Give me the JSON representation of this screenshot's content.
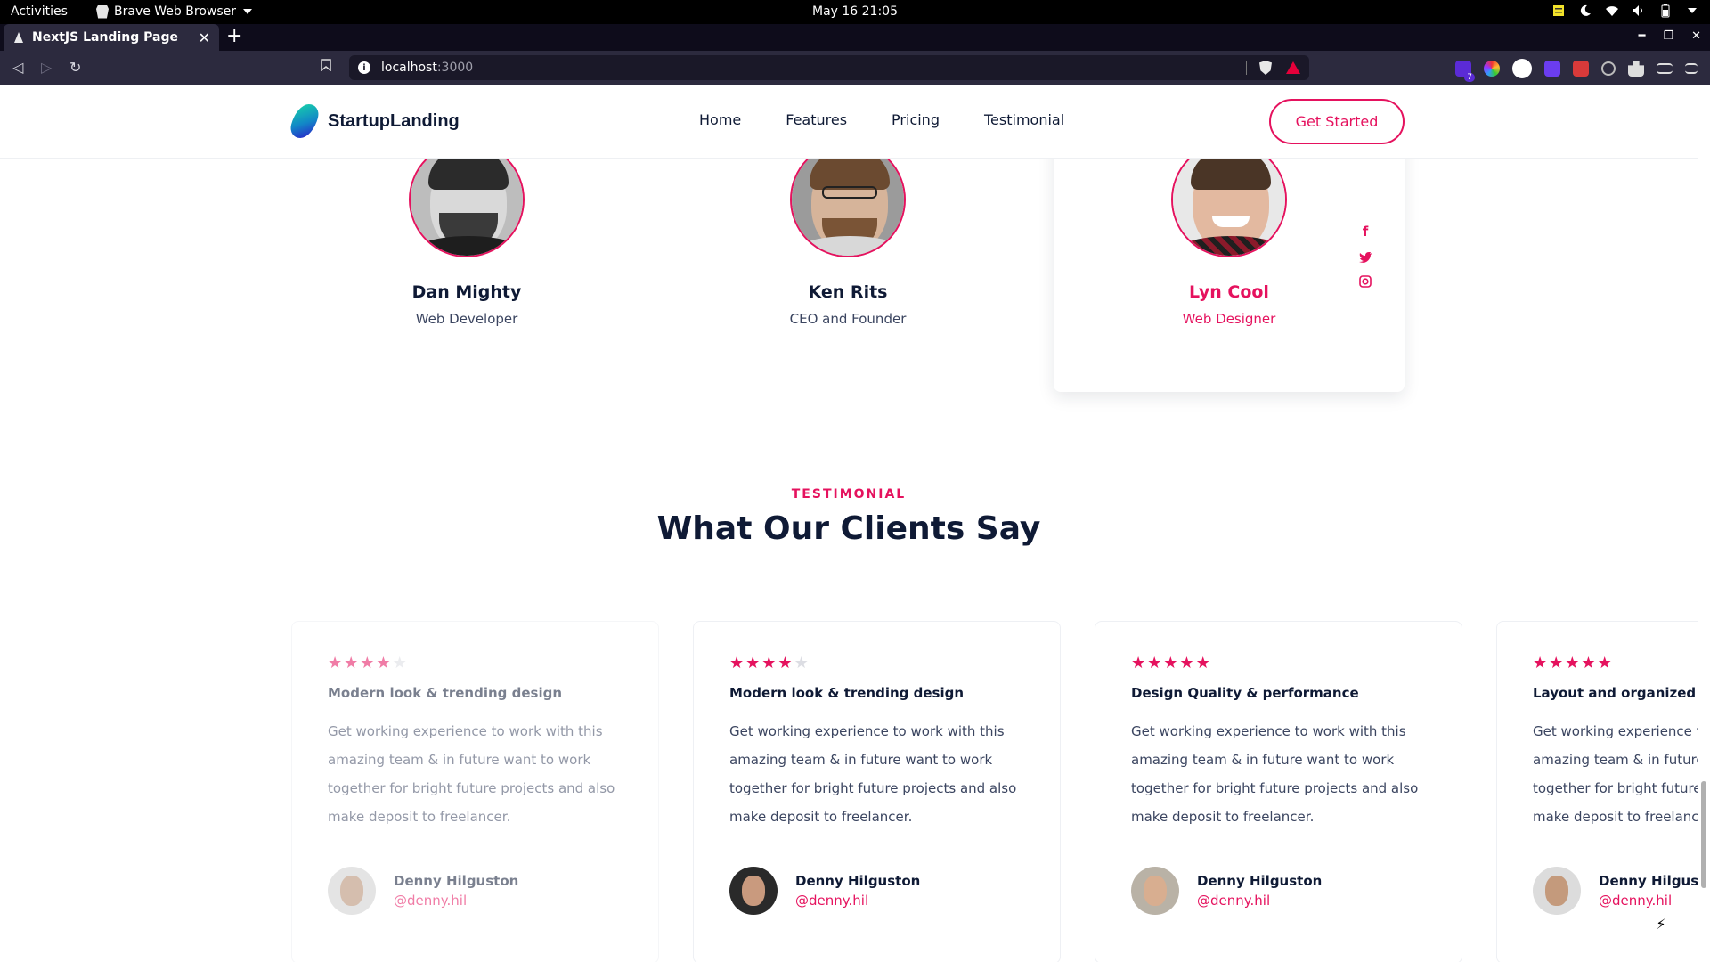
{
  "os_bar": {
    "activities": "Activities",
    "app_name": "Brave Web Browser",
    "clock": "May 16  21:05"
  },
  "browser": {
    "tab_title": "NextJS Landing Page",
    "url_host": "localhost",
    "url_port": ":3000",
    "extension_badge": "7"
  },
  "site": {
    "brand": "StartupLanding",
    "nav": [
      "Home",
      "Features",
      "Pricing",
      "Testimonial"
    ],
    "cta": "Get Started"
  },
  "team": [
    {
      "name": "Dan Mighty",
      "role": "Web Developer"
    },
    {
      "name": "Ken Rits",
      "role": "CEO and Founder"
    },
    {
      "name": "Lyn Cool",
      "role": "Web Designer"
    }
  ],
  "testimonial_section": {
    "eyebrow": "TESTIMONIAL",
    "title": "What Our Clients Say"
  },
  "testimonials": [
    {
      "rating": 4,
      "heading": "Modern look & trending design",
      "body": "Get working experience to work with this amazing team & in future want to work together for bright future projects and also make deposit to freelancer.",
      "name": "Denny Hilguston",
      "handle": "@denny.hil"
    },
    {
      "rating": 4,
      "heading": "Modern look & trending design",
      "body": "Get working experience to work with this amazing team & in future want to work together for bright future projects and also make deposit to freelancer.",
      "name": "Denny Hilguston",
      "handle": "@denny.hil"
    },
    {
      "rating": 5,
      "heading": "Design Quality & performance",
      "body": "Get working experience to work with this amazing team & in future want to work together for bright future projects and also make deposit to freelancer.",
      "name": "Denny Hilguston",
      "handle": "@denny.hil"
    },
    {
      "rating": 5,
      "heading": "Layout and organized layers",
      "body": "Get working experience to work with this amazing team & in future want to work together for bright future projects and also make deposit to freelancer.",
      "name": "Denny Hilguston",
      "handle": "@denny.hil"
    }
  ],
  "colors": {
    "accent": "#e5125e",
    "text_dark": "#0f1a35",
    "browser_chrome": "#2c2a3e"
  }
}
